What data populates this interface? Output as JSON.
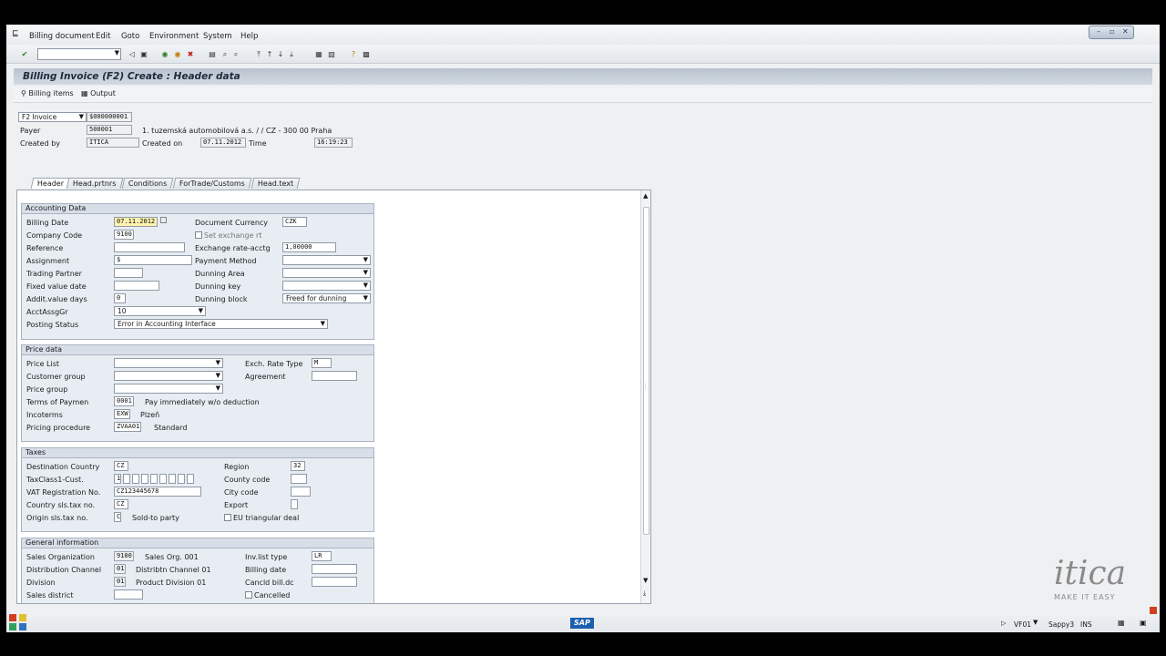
{
  "menu": {
    "items": [
      "Billing document",
      "Edit",
      "Goto",
      "Environment",
      "System",
      "Help"
    ]
  },
  "toolbar": {
    "command_value": ""
  },
  "title": "Billing Invoice (F2) Create : Header data",
  "app_toolbar": {
    "billing_items": "Billing items",
    "output": "Output"
  },
  "header": {
    "doc_type": "F2 Invoice",
    "doc_number": "$000000001",
    "payer_label": "Payer",
    "payer_value": "500001",
    "payer_desc": "1. tuzemská automobilová a.s. /  / CZ - 300 00 Praha",
    "created_by_label": "Created by",
    "created_by_value": "ITICA",
    "created_on_label": "Created on",
    "created_on_value": "07.11.2012",
    "time_label": "Time",
    "time_value": "16:19:23"
  },
  "tabs": [
    "Header",
    "Head.prtnrs",
    "Conditions",
    "ForTrade/Customs",
    "Head.text"
  ],
  "accounting": {
    "title": "Accounting Data",
    "billing_date_label": "Billing Date",
    "billing_date": "07.11.2012",
    "doc_currency_label": "Document Currency",
    "doc_currency": "CZK",
    "company_code_label": "Company Code",
    "company_code": "9100",
    "set_exchange_label": "Set exchange rt",
    "reference_label": "Reference",
    "reference": "",
    "exchange_rate_label": "Exchange rate-acctg",
    "exchange_rate": "1,00000",
    "assignment_label": "Assignment",
    "assignment": "$",
    "payment_method_label": "Payment Method",
    "payment_method": "",
    "trading_partner_label": "Trading Partner",
    "trading_partner": "",
    "dunning_area_label": "Dunning Area",
    "dunning_area": "",
    "fixed_value_label": "Fixed value date",
    "fixed_value": "",
    "dunning_key_label": "Dunning key",
    "dunning_key": "",
    "addit_days_label": "Addit.value days",
    "addit_days": "0",
    "dunning_block_label": "Dunning block",
    "dunning_block": "Freed for dunning",
    "acct_assgr_label": "AcctAssgGr",
    "acct_assgr": "10",
    "posting_status_label": "Posting Status",
    "posting_status": "Error in Accounting Interface"
  },
  "price": {
    "title": "Price data",
    "price_list_label": "Price List",
    "price_list": "",
    "exch_rate_type_label": "Exch. Rate Type",
    "exch_rate_type": "M",
    "customer_group_label": "Customer group",
    "customer_group": "",
    "agreement_label": "Agreement",
    "agreement": "",
    "price_group_label": "Price group",
    "price_group": "",
    "terms_label": "Terms of Paymen",
    "terms": "0001",
    "terms_desc": "Pay immediately w/o deduction",
    "incoterms_label": "Incoterms",
    "incoterms": "EXW",
    "incoterms_desc": "Plzeň",
    "pricing_label": "Pricing procedure",
    "pricing": "ZVAA01",
    "pricing_desc": "Standard"
  },
  "taxes": {
    "title": "Taxes",
    "dest_country_label": "Destination Country",
    "dest_country": "CZ",
    "region_label": "Region",
    "region": "32",
    "taxclass_label": "TaxClass1-Cust.",
    "taxclass": "1",
    "county_label": "County code",
    "county": "",
    "vat_label": "VAT Registration No.",
    "vat": "CZ123445678",
    "city_label": "City code",
    "city": "",
    "country_sls_label": "Country sls.tax no.",
    "country_sls": "CZ",
    "export_label": "Export",
    "export": "",
    "origin_label": "Origin sls.tax no.",
    "origin": "C",
    "origin_desc": "Sold-to party",
    "eu_label": "EU triangular deal"
  },
  "general": {
    "title": "General information",
    "sales_org_label": "Sales Organization",
    "sales_org": "9100",
    "sales_org_desc": "Sales Org. 001",
    "invlist_label": "Inv.list type",
    "invlist": "LR",
    "dist_channel_label": "Distribution Channel",
    "dist_channel": "01",
    "dist_channel_desc": "Distribtn Channel 01",
    "billing_date_label": "Billing date",
    "billing_date": "",
    "division_label": "Division",
    "division": "01",
    "division_desc": "Product Division 01",
    "cancld_label": "Cancld bill.dc",
    "cancld": "",
    "sales_district_label": "Sales district",
    "sales_district": "",
    "cancelled_label": "Cancelled"
  },
  "status_bar": {
    "transaction": "VF01",
    "server": "Sappy3",
    "mode": "INS",
    "sap_logo": "SAP"
  },
  "watermark": {
    "brand": "itica",
    "tagline": "MAKE IT EASY"
  }
}
